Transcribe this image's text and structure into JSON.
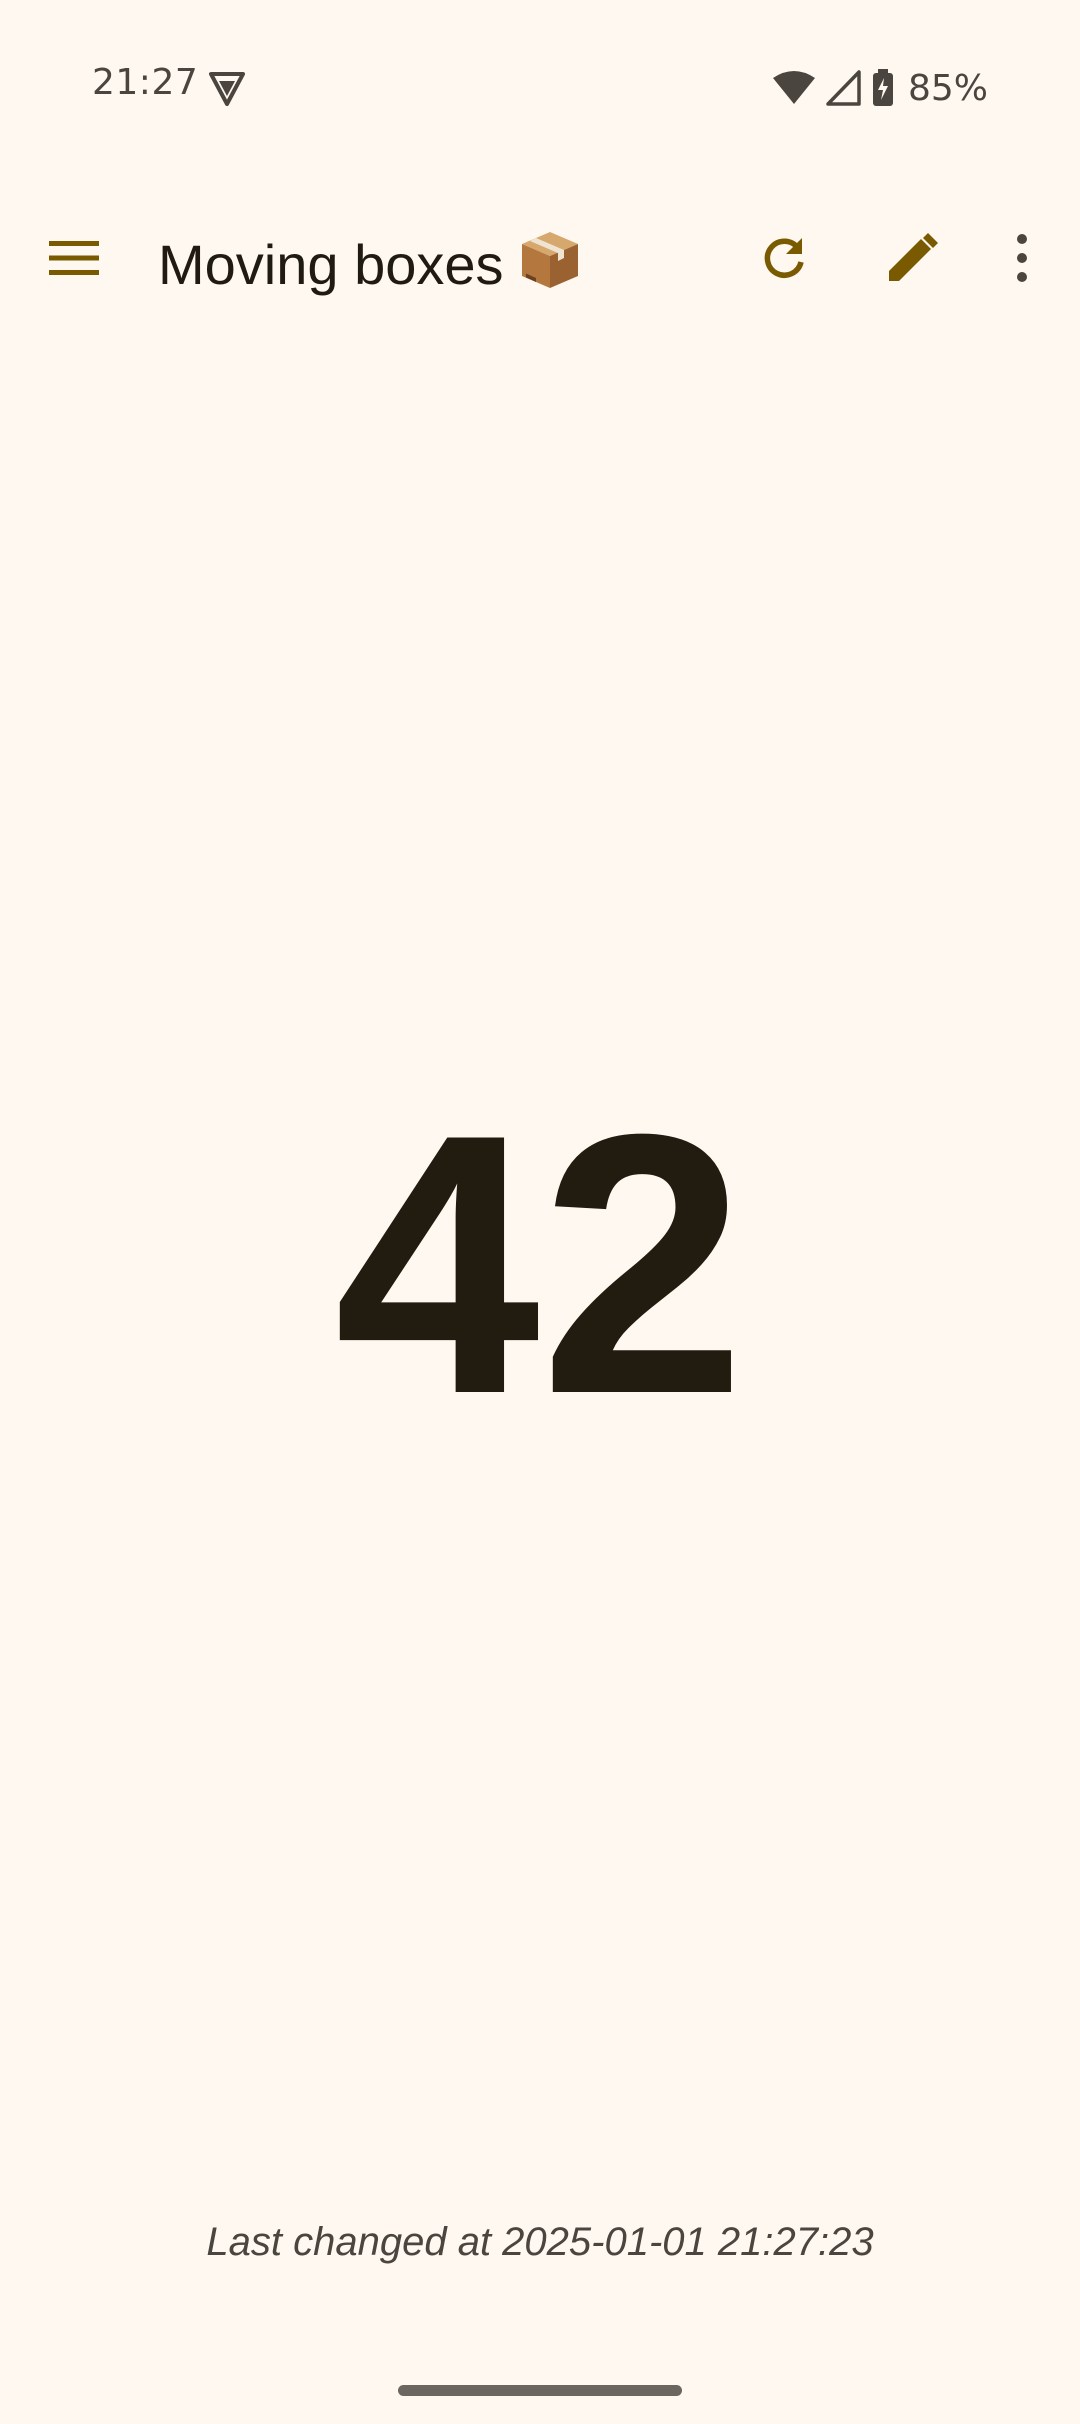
{
  "status_bar": {
    "time": "21:27",
    "battery_percent": "85%",
    "icons": [
      "vpn-icon",
      "wifi-icon",
      "cell-signal-icon",
      "battery-charging-icon"
    ]
  },
  "app_bar": {
    "title": "Moving boxes",
    "title_emoji": "package-box-emoji",
    "icons": [
      "menu-icon",
      "refresh-icon",
      "edit-icon",
      "more-vert-icon"
    ],
    "accent_color": "#7a5a00"
  },
  "counter": {
    "value": "42"
  },
  "footer": {
    "last_changed": "Last changed at 2025-01-01 21:27:23"
  }
}
